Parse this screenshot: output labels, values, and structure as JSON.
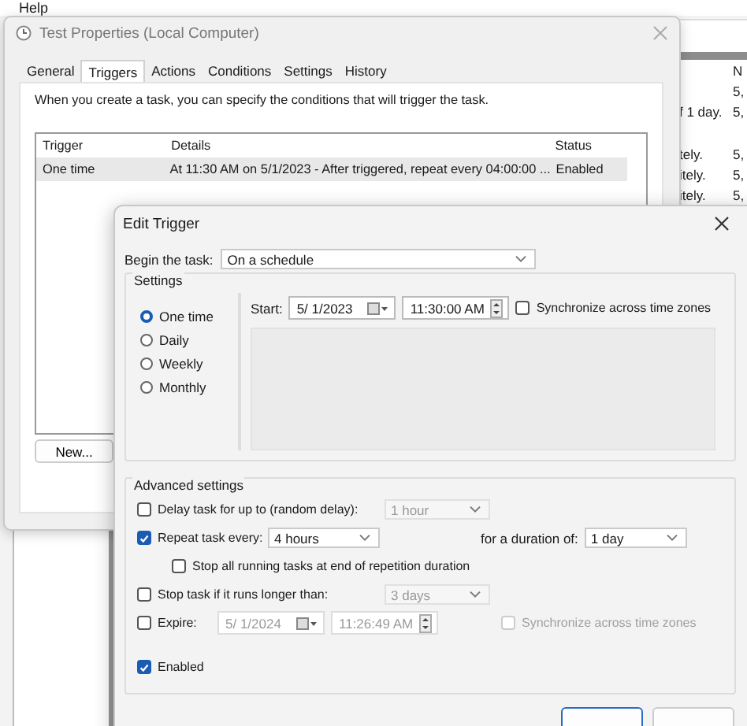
{
  "background_app": {
    "menu": [
      "Help"
    ],
    "column_header": "N",
    "rows": [
      {
        "col_1": "",
        "col_2": "5,"
      },
      {
        "col_1": "f 1 day.",
        "col_2": "5,"
      },
      {
        "col_1": "tely.",
        "col_2": "5,"
      },
      {
        "col_1": "itely.",
        "col_2": "5,"
      },
      {
        "col_1": "itely.",
        "col_2": "5,"
      }
    ]
  },
  "properties_window": {
    "title": "Test Properties (Local Computer)",
    "tabs": [
      {
        "label": "General",
        "selected": false
      },
      {
        "label": "Triggers",
        "selected": true
      },
      {
        "label": "Actions",
        "selected": false
      },
      {
        "label": "Conditions",
        "selected": false
      },
      {
        "label": "Settings",
        "selected": false
      },
      {
        "label": "History",
        "selected": false
      }
    ],
    "description": "When you create a task, you can specify the conditions that will trigger the task.",
    "table": {
      "columns": [
        "Trigger",
        "Details",
        "Status"
      ],
      "rows": [
        {
          "trigger": "One time",
          "details": "At 11:30 AM on 5/1/2023 - After triggered, repeat every 04:00:00 ...",
          "status": "Enabled",
          "selected": true
        }
      ]
    },
    "buttons": [
      "New..."
    ]
  },
  "edit_trigger": {
    "title": "Edit Trigger",
    "begin_task": {
      "label": "Begin the task:",
      "value": "On a schedule"
    },
    "settings": {
      "label": "Settings",
      "schedule_options": [
        {
          "label": "One time",
          "selected": true
        },
        {
          "label": "Daily",
          "selected": false
        },
        {
          "label": "Weekly",
          "selected": false
        },
        {
          "label": "Monthly",
          "selected": false
        }
      ],
      "start": {
        "label": "Start:",
        "date": "5/  1/2023",
        "time": "11:30:00 AM"
      },
      "sync": {
        "label": "Synchronize across time zones",
        "checked": false
      }
    },
    "advanced": {
      "label": "Advanced settings",
      "delay": {
        "label": "Delay task for up to (random delay):",
        "checked": false,
        "value": "1 hour"
      },
      "repeat": {
        "label": "Repeat task every:",
        "checked": true,
        "value": "4 hours",
        "duration_label": "for a duration of:",
        "duration_value": "1 day"
      },
      "stop_all": {
        "label": "Stop all running tasks at end of repetition duration",
        "checked": false
      },
      "stop_if_longer": {
        "label": "Stop task if it runs longer than:",
        "checked": false,
        "value": "3 days"
      },
      "expire": {
        "label": "Expire:",
        "checked": false,
        "date": "5/  1/2024",
        "time": "11:26:49 AM",
        "sync_label": "Synchronize across time zones",
        "sync_checked": false
      },
      "enabled": {
        "label": "Enabled",
        "checked": true
      }
    }
  }
}
